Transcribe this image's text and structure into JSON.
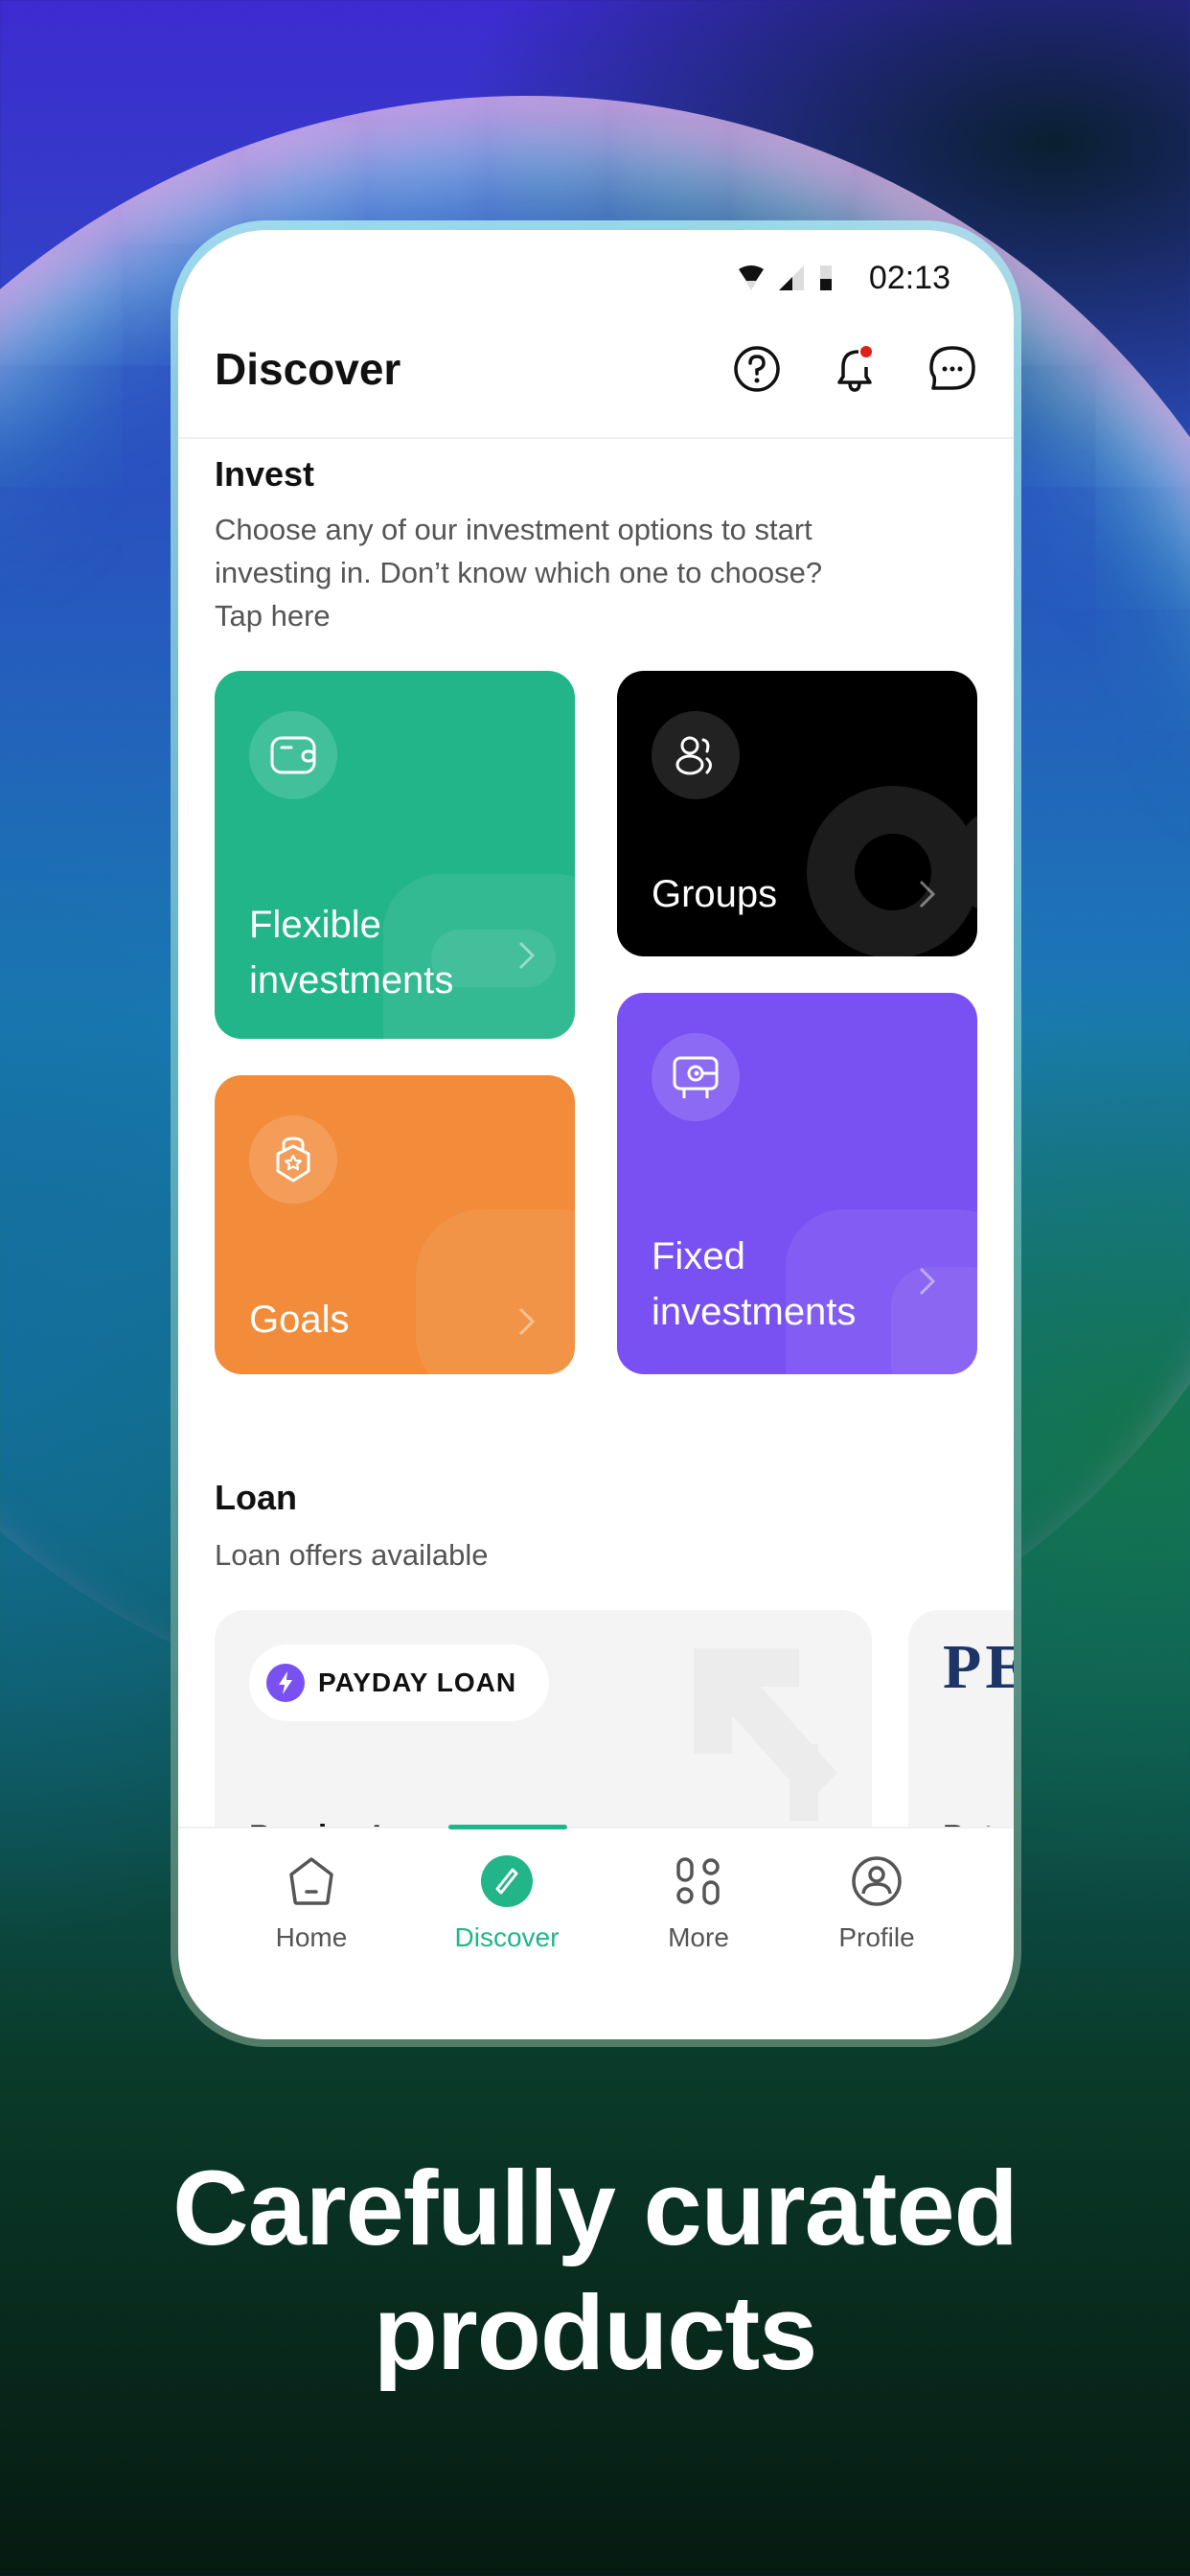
{
  "status_bar": {
    "time": "02:13"
  },
  "header": {
    "title": "Discover",
    "icons": [
      "help-icon",
      "notification-bell-icon",
      "chat-icon"
    ],
    "notification_dot_color": "#e0211b"
  },
  "invest": {
    "title": "Invest",
    "description": "Choose any of our investment options to start investing in. Don’t know which one to choose?",
    "link": "Tap here",
    "cards": [
      {
        "label_line1": "Flexible",
        "label_line2": "investments",
        "icon": "wallet-icon",
        "color": "#22b58a"
      },
      {
        "label_line1": "Groups",
        "label_line2": "",
        "icon": "group-icon",
        "color": "#000000"
      },
      {
        "label_line1": "Goals",
        "label_line2": "",
        "icon": "goal-lock-star-icon",
        "color": "#f28c3b"
      },
      {
        "label_line1": "Fixed",
        "label_line2": "investments",
        "icon": "safe-icon",
        "color": "#7950f2"
      }
    ]
  },
  "loan": {
    "title": "Loan",
    "subtitle": "Loan offers available",
    "cards": [
      {
        "badge": "PAYDAY LOAN",
        "title": "Payday Loans"
      },
      {
        "logo_text": "PE",
        "title": "Petr"
      }
    ]
  },
  "bottom_nav": {
    "items": [
      {
        "label": "Home",
        "icon": "home-icon",
        "active": false
      },
      {
        "label": "Discover",
        "icon": "compass-icon",
        "active": true
      },
      {
        "label": "More",
        "icon": "grid-icon",
        "active": false
      },
      {
        "label": "Profile",
        "icon": "profile-icon",
        "active": false
      }
    ],
    "accent": "#22b58a"
  },
  "marketing": {
    "headline_line1": "Carefully curated",
    "headline_line2": "products"
  }
}
